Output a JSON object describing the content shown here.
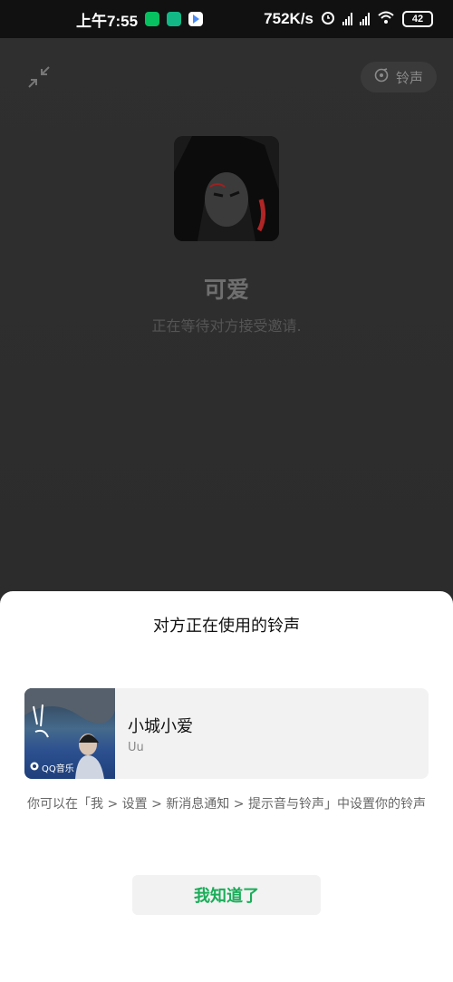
{
  "status_bar": {
    "time": "上午7:55",
    "net_speed": "752K/s",
    "battery": "42",
    "colors": {
      "wechat": "#07c160",
      "teal_app": "#12b886",
      "play_app": "#4c8bf5"
    }
  },
  "call": {
    "ringtone_chip_label": "铃声",
    "contact_name": "可爱",
    "waiting_text": "正在等待对方接受邀请."
  },
  "sheet": {
    "title": "对方正在使用的铃声",
    "song": {
      "title": "小城小爱",
      "artist": "Uu",
      "cover_tag": "QQ音乐"
    },
    "hint": "你可以在「我 > 设置 > 新消息通知 > 提示音与铃声」中设置你的铃声",
    "confirm_button": "我知道了"
  },
  "accent_color": "#1aad59"
}
